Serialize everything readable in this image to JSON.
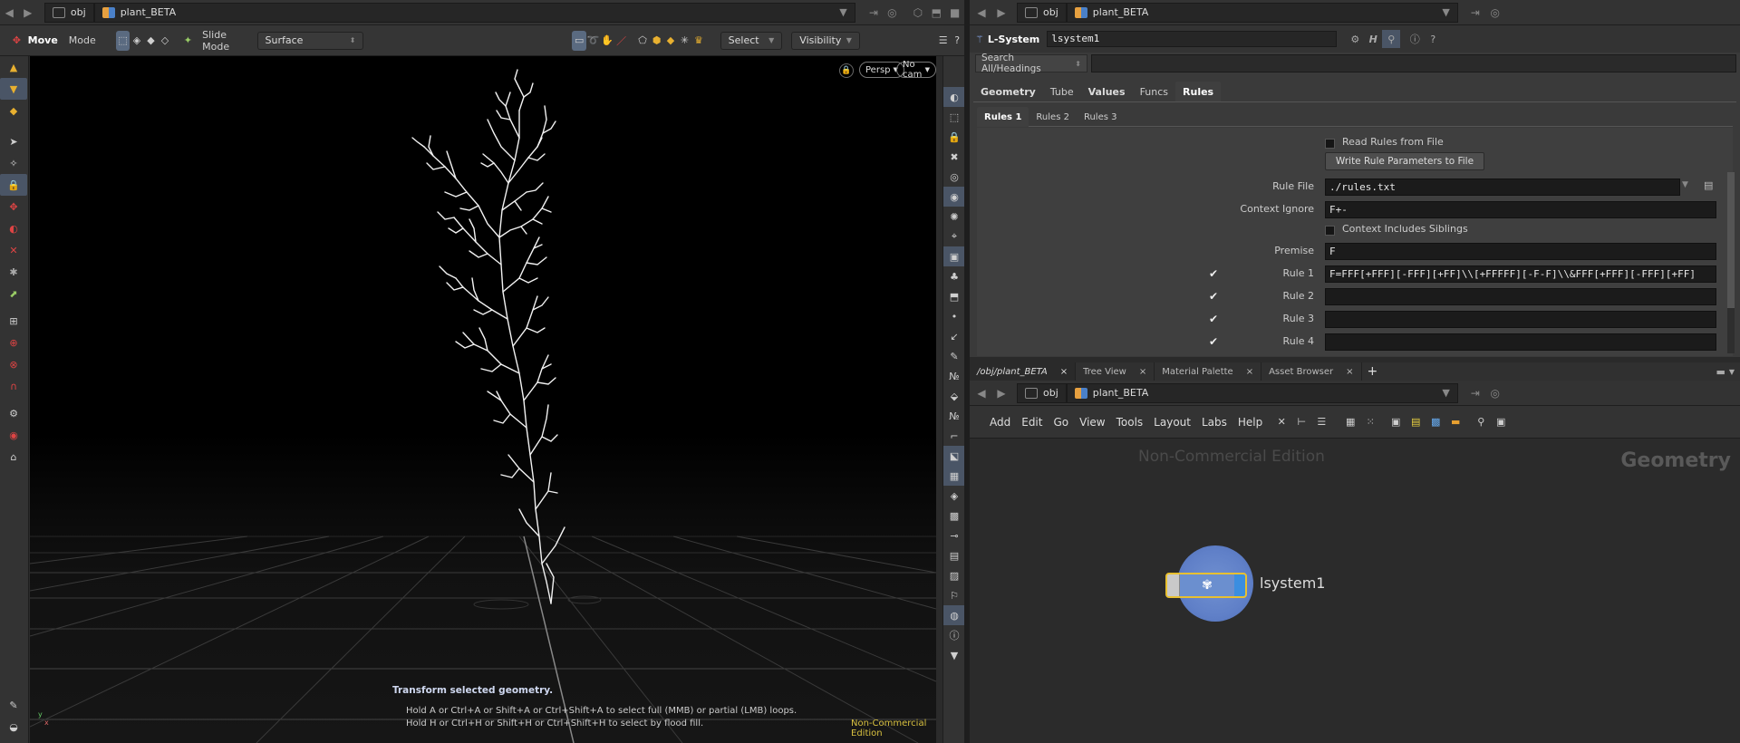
{
  "viewer": {
    "path": {
      "root": "obj",
      "node": "plant_BETA"
    },
    "toolbar": {
      "tool_name": "Move",
      "mode_label": "Mode",
      "slide_mode_label": "Slide Mode",
      "slide_mode_value": "Surface",
      "select_value": "Select",
      "visibility_value": "Visibility"
    },
    "camera": {
      "persp": "Persp",
      "nocam": "No cam"
    },
    "hud": {
      "title": "Transform selected geometry.",
      "line1": "Hold A or Ctrl+A or Shift+A or Ctrl+Shift+A to select full (MMB) or partial (LMB) loops.",
      "line2": "Hold H or Ctrl+H or Shift+H or Ctrl+Shift+H to select by flood fill.",
      "edition": "Non-Commercial Edition"
    },
    "axis_labels": {
      "y": "y",
      "x": "x"
    }
  },
  "params": {
    "path": {
      "root": "obj",
      "node": "plant_BETA"
    },
    "node_type": "L-System",
    "node_name": "lsystem1",
    "search_placeholder": "Search All/Headings",
    "tabs": [
      "Geometry",
      "Tube",
      "Values",
      "Funcs",
      "Rules"
    ],
    "active_tab": "Rules",
    "subtabs": [
      "Rules 1",
      "Rules 2",
      "Rules 3"
    ],
    "read_rules_label": "Read Rules from File",
    "write_rules_button": "Write Rule Parameters to File",
    "rule_file_label": "Rule File",
    "rule_file_value": "./rules.txt",
    "context_ignore_label": "Context Ignore",
    "context_ignore_value": "F+-",
    "context_siblings_label": "Context Includes Siblings",
    "premise_label": "Premise",
    "premise_value": "F",
    "rules": [
      {
        "label": "Rule 1",
        "value": "F=FFF[+FFF][-FFF][+FF]\\\\[+FFFFF][-F-F]\\\\&FFF[+FFF][-FFF][+FF]"
      },
      {
        "label": "Rule 2",
        "value": ""
      },
      {
        "label": "Rule 3",
        "value": ""
      },
      {
        "label": "Rule 4",
        "value": ""
      }
    ]
  },
  "network": {
    "tabs": [
      "/obj/plant_BETA",
      "Tree View",
      "Material Palette",
      "Asset Browser"
    ],
    "path": {
      "root": "obj",
      "node": "plant_BETA"
    },
    "menu": [
      "Add",
      "Edit",
      "Go",
      "View",
      "Tools",
      "Layout",
      "Labs",
      "Help"
    ],
    "watermark": "Non-Commercial Edition",
    "context_label": "Geometry",
    "node_label": "lsystem1"
  }
}
